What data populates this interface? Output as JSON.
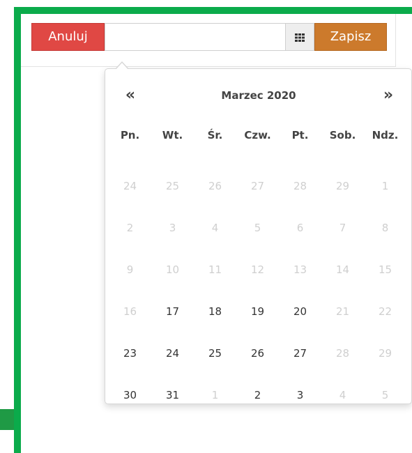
{
  "toolbar": {
    "cancel_label": "Anuluj",
    "date_value": "",
    "save_label": "Zapisz",
    "calendar_icon": "calendar-grid-icon"
  },
  "datepicker": {
    "title": "Marzec 2020",
    "prev_label": "«",
    "next_label": "»",
    "weekdays": [
      "Pn.",
      "Wt.",
      "Śr.",
      "Czw.",
      "Pt.",
      "Sob.",
      "Ndz."
    ],
    "weeks": [
      [
        {
          "d": "24",
          "s": "muted"
        },
        {
          "d": "25",
          "s": "muted"
        },
        {
          "d": "26",
          "s": "muted"
        },
        {
          "d": "27",
          "s": "muted"
        },
        {
          "d": "28",
          "s": "muted"
        },
        {
          "d": "29",
          "s": "muted"
        },
        {
          "d": "1",
          "s": "muted"
        }
      ],
      [
        {
          "d": "2",
          "s": "muted"
        },
        {
          "d": "3",
          "s": "muted"
        },
        {
          "d": "4",
          "s": "muted"
        },
        {
          "d": "5",
          "s": "muted"
        },
        {
          "d": "6",
          "s": "muted"
        },
        {
          "d": "7",
          "s": "muted"
        },
        {
          "d": "8",
          "s": "muted"
        }
      ],
      [
        {
          "d": "9",
          "s": "muted"
        },
        {
          "d": "10",
          "s": "muted"
        },
        {
          "d": "11",
          "s": "muted"
        },
        {
          "d": "12",
          "s": "muted"
        },
        {
          "d": "13",
          "s": "muted"
        },
        {
          "d": "14",
          "s": "muted"
        },
        {
          "d": "15",
          "s": "muted"
        }
      ],
      [
        {
          "d": "16",
          "s": "muted"
        },
        {
          "d": "17",
          "s": "active"
        },
        {
          "d": "18",
          "s": "active"
        },
        {
          "d": "19",
          "s": "active"
        },
        {
          "d": "20",
          "s": "active"
        },
        {
          "d": "21",
          "s": "muted"
        },
        {
          "d": "22",
          "s": "muted"
        }
      ],
      [
        {
          "d": "23",
          "s": "active"
        },
        {
          "d": "24",
          "s": "active"
        },
        {
          "d": "25",
          "s": "active"
        },
        {
          "d": "26",
          "s": "active"
        },
        {
          "d": "27",
          "s": "active"
        },
        {
          "d": "28",
          "s": "muted"
        },
        {
          "d": "29",
          "s": "muted"
        }
      ],
      [
        {
          "d": "30",
          "s": "active"
        },
        {
          "d": "31",
          "s": "active"
        },
        {
          "d": "1",
          "s": "muted"
        },
        {
          "d": "2",
          "s": "active"
        },
        {
          "d": "3",
          "s": "active"
        },
        {
          "d": "4",
          "s": "muted"
        },
        {
          "d": "5",
          "s": "muted"
        }
      ]
    ]
  },
  "colors": {
    "frame": "#0bab4b",
    "cancel": "#e04844",
    "save": "#cc7a2c"
  }
}
